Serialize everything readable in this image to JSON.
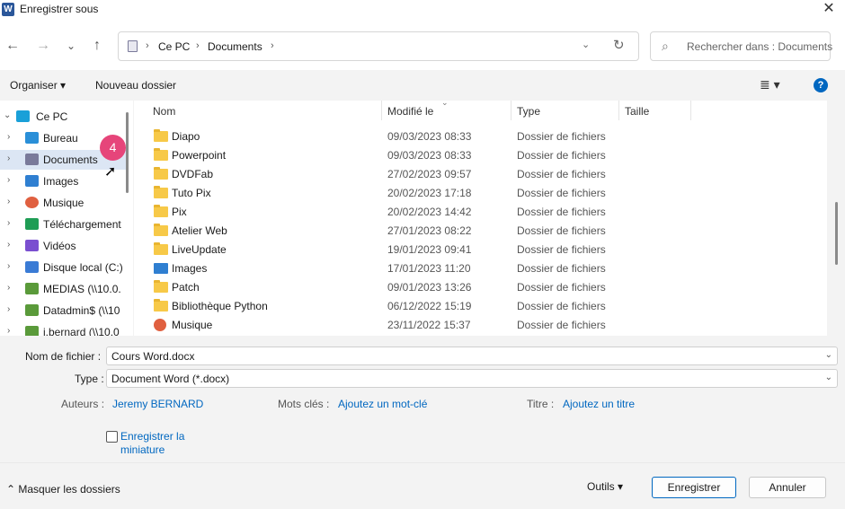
{
  "window": {
    "title": "Enregistrer sous",
    "app_icon": "W",
    "close": "✕"
  },
  "nav": {
    "back": "←",
    "forward": "→",
    "recent": "⌄",
    "up": "↑",
    "breadcrumbs": [
      "Ce PC",
      "Documents"
    ],
    "search_placeholder": "Rechercher dans : Documents"
  },
  "toolbar": {
    "organize": "Organiser ▾",
    "new_folder": "Nouveau dossier",
    "view": "≣ ▾",
    "help": "?"
  },
  "sidebar": {
    "items": [
      {
        "label": "Ce PC",
        "chev": "⌄",
        "icon": "pc-icon",
        "color": "#1aa0d8"
      },
      {
        "label": "Bureau",
        "chev": "›",
        "icon": "desktop-icon",
        "color": "#2a8fd8"
      },
      {
        "label": "Documents",
        "chev": "›",
        "icon": "documents-icon",
        "color": "#7a7a9a"
      },
      {
        "label": "Images",
        "chev": "›",
        "icon": "images-icon",
        "color": "#2f7fd1"
      },
      {
        "label": "Musique",
        "chev": "›",
        "icon": "music-icon",
        "color": "#e06040"
      },
      {
        "label": "Téléchargement",
        "chev": "›",
        "icon": "download-icon",
        "color": "#1f9d55"
      },
      {
        "label": "Vidéos",
        "chev": "›",
        "icon": "videos-icon",
        "color": "#7a4fd0"
      },
      {
        "label": "Disque local (C:)",
        "chev": "›",
        "icon": "disk-icon",
        "color": "#3a7bd5"
      },
      {
        "label": "MEDIAS (\\\\10.0.",
        "chev": "›",
        "icon": "network-drive-icon",
        "color": "#5a9a3a"
      },
      {
        "label": "Datadmin$ (\\\\10",
        "chev": "›",
        "icon": "network-drive-icon",
        "color": "#5a9a3a"
      },
      {
        "label": "j.bernard (\\\\10.0",
        "chev": "›",
        "icon": "network-drive-icon",
        "color": "#5a9a3a"
      }
    ],
    "selected_index": 2,
    "badge": "4"
  },
  "files": {
    "columns": [
      "Nom",
      "Modifié le",
      "Type",
      "Taille"
    ],
    "rows": [
      {
        "name": "Diapo",
        "date": "09/03/2023 08:33",
        "type": "Dossier de fichiers",
        "icon": "folder-icon"
      },
      {
        "name": "Powerpoint",
        "date": "09/03/2023 08:33",
        "type": "Dossier de fichiers",
        "icon": "folder-icon"
      },
      {
        "name": "DVDFab",
        "date": "27/02/2023 09:57",
        "type": "Dossier de fichiers",
        "icon": "folder-icon"
      },
      {
        "name": "Tuto Pix",
        "date": "20/02/2023 17:18",
        "type": "Dossier de fichiers",
        "icon": "folder-icon"
      },
      {
        "name": "Pix",
        "date": "20/02/2023 14:42",
        "type": "Dossier de fichiers",
        "icon": "folder-icon"
      },
      {
        "name": "Atelier Web",
        "date": "27/01/2023 08:22",
        "type": "Dossier de fichiers",
        "icon": "folder-icon"
      },
      {
        "name": "LiveUpdate",
        "date": "19/01/2023 09:41",
        "type": "Dossier de fichiers",
        "icon": "folder-icon"
      },
      {
        "name": "Images",
        "date": "17/01/2023 11:20",
        "type": "Dossier de fichiers",
        "icon": "images-icon"
      },
      {
        "name": "Patch",
        "date": "09/01/2023 13:26",
        "type": "Dossier de fichiers",
        "icon": "folder-icon"
      },
      {
        "name": "Bibliothèque Python",
        "date": "06/12/2022 15:19",
        "type": "Dossier de fichiers",
        "icon": "folder-icon"
      },
      {
        "name": "Musique",
        "date": "23/11/2022 15:37",
        "type": "Dossier de fichiers",
        "icon": "music-icon"
      }
    ]
  },
  "form": {
    "filename_label": "Nom de fichier :",
    "filename_value": "Cours Word.docx",
    "type_label": "Type :",
    "type_value": "Document Word (*.docx)",
    "authors_label": "Auteurs :",
    "authors_value": "Jeremy BERNARD",
    "keywords_label": "Mots clés :",
    "keywords_value": "Ajoutez un mot-clé",
    "title_label": "Titre :",
    "title_value": "Ajoutez un titre",
    "thumbnail_label": "Enregistrer la miniature"
  },
  "footer": {
    "hide_folders": "⌃  Masquer les dossiers",
    "tools": "Outils  ▾",
    "save": "Enregistrer",
    "cancel": "Annuler"
  }
}
